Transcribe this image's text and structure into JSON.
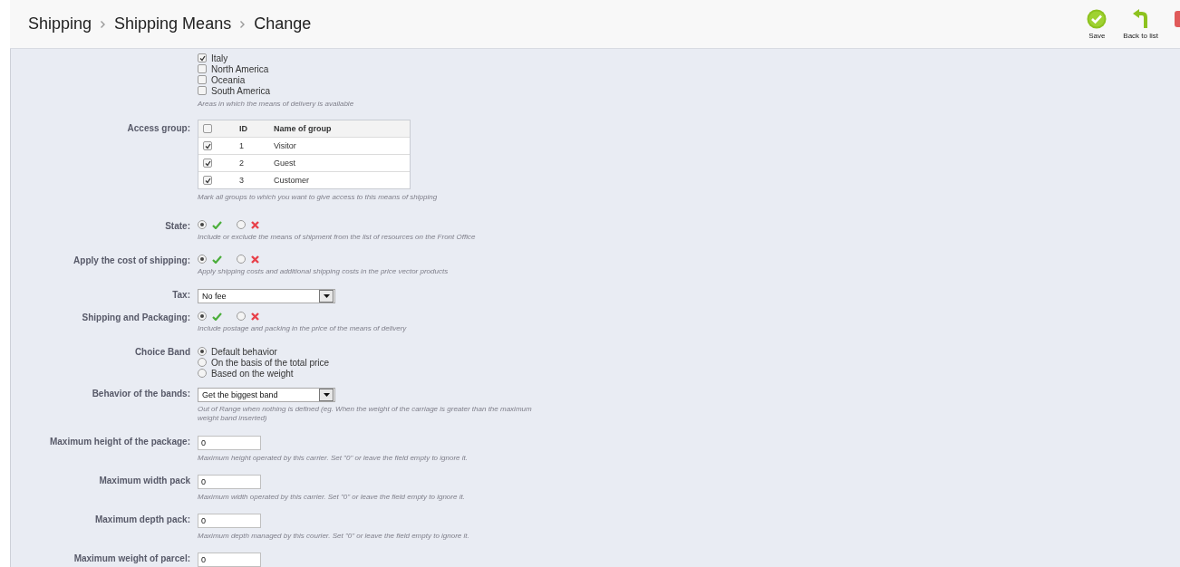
{
  "header": {
    "breadcrumb": [
      "Shipping",
      "Shipping Means",
      "Change"
    ],
    "toolbar": [
      {
        "kind": "save",
        "label": "Save"
      },
      {
        "kind": "back",
        "label": "Back to list"
      },
      {
        "kind": "cut"
      }
    ]
  },
  "fields": [
    {
      "kind": "checklist",
      "items": [
        {
          "label": "Italy",
          "checked": true
        },
        {
          "label": "North America",
          "checked": false
        },
        {
          "label": "Oceania",
          "checked": false
        },
        {
          "label": "South America",
          "checked": false
        }
      ],
      "help": "Areas in which the means of delivery is available"
    },
    {
      "kind": "group_table",
      "label": "Access group:",
      "columns": [
        "ID",
        "Name of group"
      ],
      "all_checked": false,
      "rows": [
        {
          "id": "1",
          "name": "Visitor",
          "checked": true
        },
        {
          "id": "2",
          "name": "Guest",
          "checked": true
        },
        {
          "id": "3",
          "name": "Customer",
          "checked": true
        }
      ],
      "help": "Mark all groups to which you want to give access to this means of shipping"
    },
    {
      "kind": "toggle",
      "label": "State:",
      "on": true,
      "help": "Include or exclude the means of shipment from the list of resources on the Front Office"
    },
    {
      "kind": "toggle",
      "label": "Apply the cost of shipping:",
      "on": true,
      "help": "Apply shipping costs and additional shipping costs in the price vector products"
    },
    {
      "kind": "select",
      "label": "Tax:",
      "value": "No fee"
    },
    {
      "kind": "toggle",
      "label": "Shipping and Packaging:",
      "on": true,
      "help": "Include postage and packing in the price of the means of delivery"
    },
    {
      "kind": "radio_list",
      "label": "Choice Band",
      "options": [
        {
          "label": "Default behavior",
          "selected": true
        },
        {
          "label": "On the basis of the total price",
          "selected": false
        },
        {
          "label": "Based on the weight",
          "selected": false
        }
      ]
    },
    {
      "kind": "select",
      "label": "Behavior of the bands:",
      "value": "Get the biggest band",
      "help": "Out of Range when nothing is defined (eg. When the weight of the carriage is greater than the maximum weight band inserted)"
    },
    {
      "kind": "text",
      "label": "Maximum height of the package:",
      "value": "0",
      "help": "Maximum height operated by this carrier. Set \"0\" or leave the field empty to ignore it."
    },
    {
      "kind": "text",
      "label": "Maximum width pack",
      "value": "0",
      "help": "Maximum width operated by this carrier. Set \"0\" or leave the field empty to ignore it."
    },
    {
      "kind": "text",
      "label": "Maximum depth pack:",
      "value": "0",
      "help": "Maximum depth managed by this courier. Set \"0\" or leave the field empty to ignore it."
    },
    {
      "kind": "text",
      "label": "Maximum weight of parcel:",
      "value": "0"
    }
  ]
}
